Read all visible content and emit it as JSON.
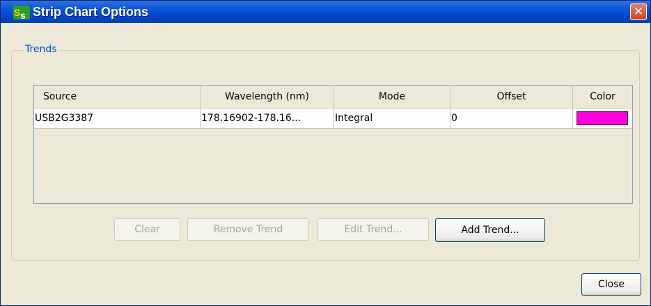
{
  "window": {
    "title": "Strip Chart Options",
    "close_glyph": "✕",
    "app_icon": "ss-app-icon"
  },
  "group": {
    "legend": "Trends"
  },
  "table": {
    "columns": [
      "Source",
      "Wavelength (nm)",
      "Mode",
      "Offset",
      "Color"
    ],
    "rows": [
      {
        "source": "USB2G3387",
        "wavelength": "178.16902-178.16...",
        "mode": "Integral",
        "offset": "0",
        "color": "#ff00dd"
      }
    ]
  },
  "buttons": {
    "clear": "Clear",
    "remove_trend": "Remove Trend",
    "edit_trend": "Edit Trend...",
    "add_trend": "Add Trend...",
    "close": "Close"
  }
}
